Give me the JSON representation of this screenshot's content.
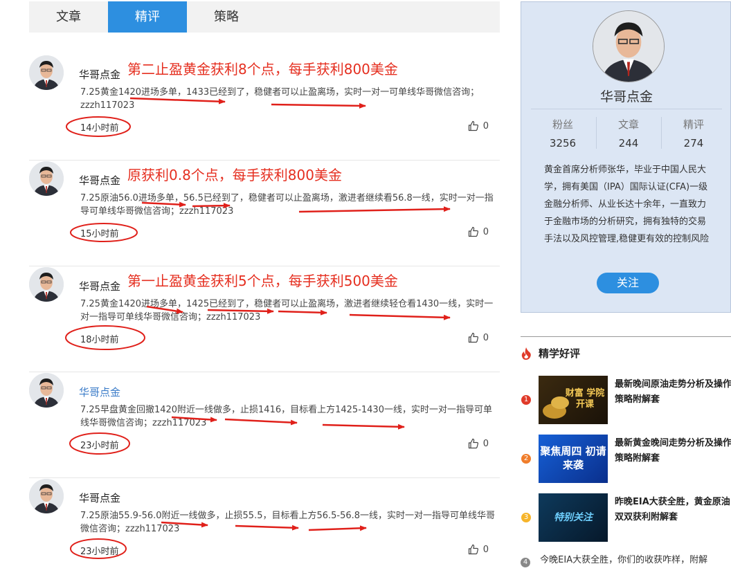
{
  "tabs": [
    {
      "label": "文章",
      "active": false
    },
    {
      "label": "精评",
      "active": true
    },
    {
      "label": "策略",
      "active": false
    }
  ],
  "posts": [
    {
      "author": "华哥点金",
      "headline": "第二止盈黄金获利8个点，每手获利800美金",
      "content": "7.25黄金1420进场多单，1433已经到了，稳健者可以止盈离场，实时一对一可单线华哥微信咨询；zzzh117023",
      "time": "14小时前",
      "likes": "0"
    },
    {
      "author": "华哥点金",
      "headline": "原获利0.8个点，每手获利800美金",
      "content": "7.25原油56.0进场多单，56.5已经到了，稳健者可以止盈离场，激进者继续看56.8一线，实时一对一指导可单线华哥微信咨询；zzzh117023",
      "time": "15小时前",
      "likes": "0"
    },
    {
      "author": "华哥点金",
      "headline": "第一止盈黄金获利5个点，每手获利500美金",
      "content": "7.25黄金1420进场多单，1425已经到了，稳健者可以止盈离场，激进者继续轻仓看1430一线，实时一对一指导可单线华哥微信咨询；zzzh117023",
      "time": "18小时前",
      "likes": "0"
    },
    {
      "author": "华哥点金",
      "headline": "",
      "content": "7.25早盘黄金回撤1420附近一线做多，止损1416，目标看上方1425-1430一线，实时一对一指导可单线华哥微信咨询；zzzh117023",
      "time": "23小时前",
      "likes": "0"
    },
    {
      "author": "华哥点金",
      "headline": "",
      "content": "7.25原油55.9-56.0附近一线做多，止损55.5，目标看上方56.5-56.8一线，实时一对一指导可单线华哥微信咨询；zzzh117023",
      "time": "23小时前",
      "likes": "0"
    }
  ],
  "profile": {
    "name": "华哥点金",
    "stats": [
      {
        "label": "粉丝",
        "value": "3256"
      },
      {
        "label": "文章",
        "value": "244"
      },
      {
        "label": "精评",
        "value": "274"
      }
    ],
    "bio": "黄金首席分析师张华，毕业于中国人民大学，拥有美国（IPA）国际认证(CFA)一级金融分析师、从业长达十余年，一直致力于金融市场的分析研究，拥有独特的交易手法以及风控管理,稳健更有效的控制风险",
    "follow_label": "关注"
  },
  "recommend": {
    "title": "精学好评",
    "items": [
      {
        "rank": "1",
        "title": "最新晚间原油走势分析及操作策略附解套",
        "thumb_text": "财富 学院开课"
      },
      {
        "rank": "2",
        "title": "最新黄金晚间走势分析及操作策略附解套",
        "thumb_text": "聚焦周四 初请来袭"
      },
      {
        "rank": "3",
        "title": "昨晚EIA大获全胜，黄金原油双双获利附解套",
        "thumb_text": "特别关注"
      }
    ],
    "last": {
      "rank": "4",
      "title": "今晚EIA大获全胜，你们的收获咋样，附解"
    }
  },
  "colors": {
    "accent": "#2d8fe0",
    "headline": "#e52e1f",
    "annotation": "#e0201a",
    "rank1": "#e03b2a",
    "rank2": "#f07d2b",
    "rank3": "#f6b42a",
    "rank4": "#888888"
  }
}
